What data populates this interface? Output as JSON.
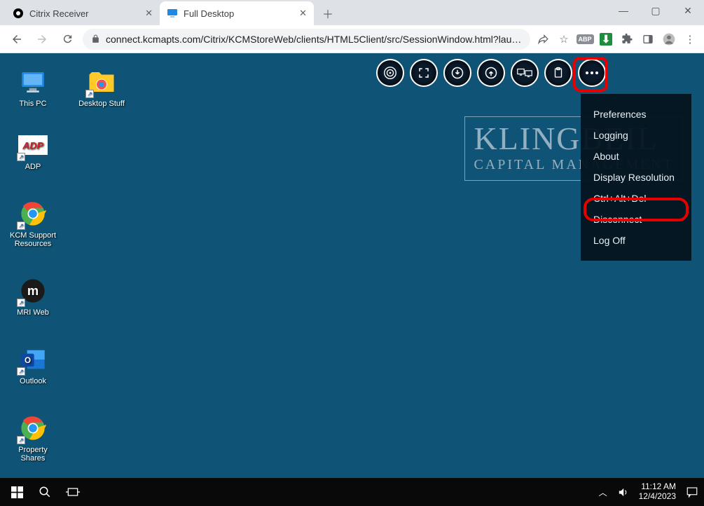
{
  "browser": {
    "tabs": [
      {
        "title": "Citrix Receiver",
        "active": false
      },
      {
        "title": "Full Desktop",
        "active": true
      }
    ],
    "url": "connect.kcmapts.com/Citrix/KCMStoreWeb/clients/HTML5Client/src/SessionWindow.html?lau…",
    "ext_abp": "ABP"
  },
  "desktop": {
    "icons_row": [
      {
        "label": "This PC"
      },
      {
        "label": "Desktop Stuff"
      }
    ],
    "icons_col": [
      {
        "label": "ADP"
      },
      {
        "label": "KCM Support Resources"
      },
      {
        "label": "MRI Web"
      },
      {
        "label": "Outlook"
      },
      {
        "label": "Property Shares"
      }
    ],
    "watermark": {
      "line1": "KLINGBEIL",
      "line2": "CAPITAL MANAGEMENT"
    }
  },
  "ctx_menu": {
    "items": [
      "Preferences",
      "Logging",
      "About",
      "Display Resolution",
      "Ctrl+Alt+Del",
      "Disconnect",
      "Log Off"
    ],
    "highlight_index": 5
  },
  "taskbar": {
    "time": "11:12 AM",
    "date": "12/4/2023"
  }
}
